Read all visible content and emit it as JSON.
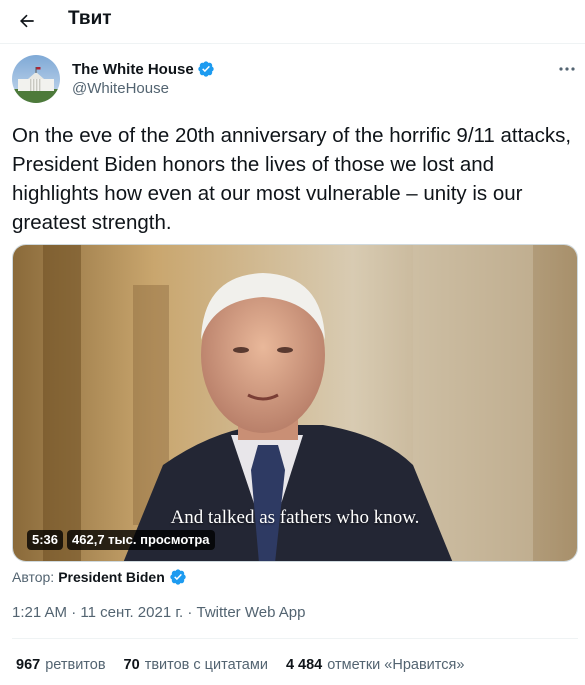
{
  "header": {
    "title": "Твит"
  },
  "author": {
    "name": "The White House",
    "handle": "@WhiteHouse",
    "verified_color": "#1d9bf0"
  },
  "tweet": {
    "text": "On the eve of the 20th anniversary of the horrific 9/11 attacks, President Biden honors the lives of those we lost and highlights how even at our most vulnerable – unity is our greatest strength."
  },
  "video": {
    "caption": "And talked as fathers who know.",
    "duration": "5:36",
    "views": "462,7 тыс. просмотра"
  },
  "attribution": {
    "prefix": "Автор:",
    "name": "President Biden"
  },
  "meta": {
    "time": "1:21 AM",
    "separator": "·",
    "date": "11 сент. 2021 г.",
    "source": "Twitter Web App"
  },
  "stats": [
    {
      "value": "967",
      "label": "ретвитов"
    },
    {
      "value": "70",
      "label": "твитов с цитатами"
    },
    {
      "value": "4 484",
      "label": "отметки «Нравится»"
    }
  ],
  "icons": {
    "back": "arrow-left-icon",
    "more": "more-horizontal-icon",
    "verified": "verified-badge-icon"
  }
}
